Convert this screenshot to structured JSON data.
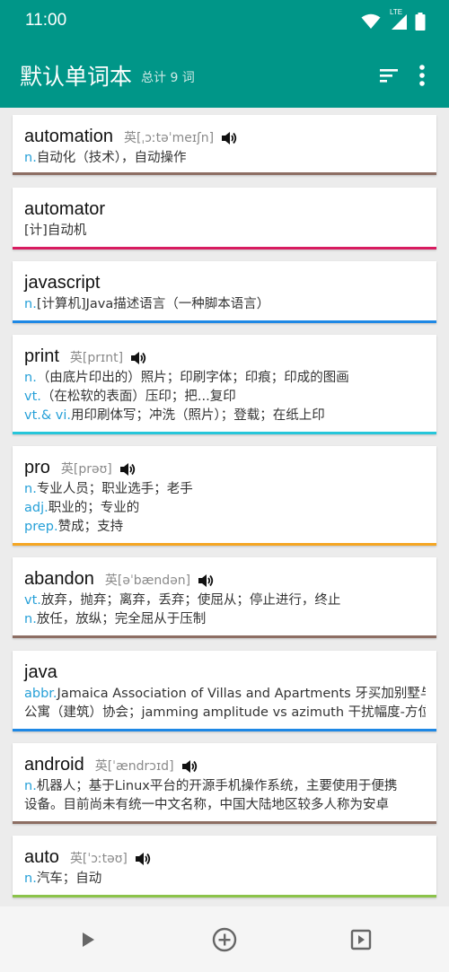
{
  "status": {
    "time": "11:00",
    "network": "LTE"
  },
  "appbar": {
    "title": "默认单词本",
    "count": "总计 9 词"
  },
  "words": [
    {
      "word": "automation",
      "phonetic": "英[ˌɔːtəˈmeɪʃn]",
      "speaker": true,
      "bar_color": "#8d6e63",
      "lines": [
        {
          "pos": "n.",
          "text": "自动化（技术），自动操作"
        }
      ]
    },
    {
      "word": "automator",
      "phonetic": "",
      "speaker": false,
      "bar_color": "#d81b60",
      "lines": [
        {
          "pos": "",
          "text": "[计]自动机"
        }
      ]
    },
    {
      "word": "javascript",
      "phonetic": "",
      "speaker": false,
      "bar_color": "#1e88e5",
      "lines": [
        {
          "pos": "n.",
          "text": "[计算机]Java描述语言（一种脚本语言）"
        }
      ]
    },
    {
      "word": "print",
      "phonetic": "英[prɪnt]",
      "speaker": true,
      "bar_color": "#26c6da",
      "lines": [
        {
          "pos": "n.",
          "text": "（由底片印出的）照片；印刷字体；印痕；印成的图画"
        },
        {
          "pos": "vt.",
          "text": "（在松软的表面）压印；把...复印"
        },
        {
          "pos": "vt.& vi.",
          "text": "用印刷体写；冲洗（照片）；登载；在纸上印"
        }
      ]
    },
    {
      "word": "pro",
      "phonetic": "英[prəʊ]",
      "speaker": true,
      "bar_color": "#f5a623",
      "lines": [
        {
          "pos": "n.",
          "text": "专业人员；职业选手；老手"
        },
        {
          "pos": "adj.",
          "text": "职业的；专业的"
        },
        {
          "pos": "prep.",
          "text": "赞成；支持"
        }
      ]
    },
    {
      "word": "abandon",
      "phonetic": "英[əˈbændən]",
      "speaker": true,
      "bar_color": "#8d6e63",
      "lines": [
        {
          "pos": "vt.",
          "text": "放弃，抛弃；离弃，丢弃；使屈从；停止进行，终止"
        },
        {
          "pos": "n.",
          "text": "放任，放纵；完全屈从于压制"
        }
      ]
    },
    {
      "word": "java",
      "phonetic": "",
      "speaker": false,
      "bar_color": "#1e88e5",
      "lines": [
        {
          "pos": "abbr.",
          "text": "Jamaica Association of Villas and Apartments 牙买加别墅与"
        },
        {
          "pos": "",
          "text": "公寓（建筑）协会；jamming amplitude vs azimuth 干扰幅度-方位"
        }
      ]
    },
    {
      "word": "android",
      "phonetic": "英[ˈændrɔɪd]",
      "speaker": true,
      "bar_color": "#8d6e63",
      "lines": [
        {
          "pos": "n.",
          "text": "机器人；基于Linux平台的开源手机操作系统，主要使用于便携"
        },
        {
          "pos": "",
          "text": "设备。目前尚未有统一中文名称，中国大陆地区较多人称为安卓"
        }
      ]
    },
    {
      "word": "auto",
      "phonetic": "英[ˈɔːtəʊ]",
      "speaker": true,
      "bar_color": "#8bc34a",
      "lines": [
        {
          "pos": "n.",
          "text": "汽车；自动"
        }
      ]
    }
  ],
  "bottom": {
    "icons": [
      "play-icon",
      "add-circle-icon",
      "slideshow-icon"
    ]
  }
}
